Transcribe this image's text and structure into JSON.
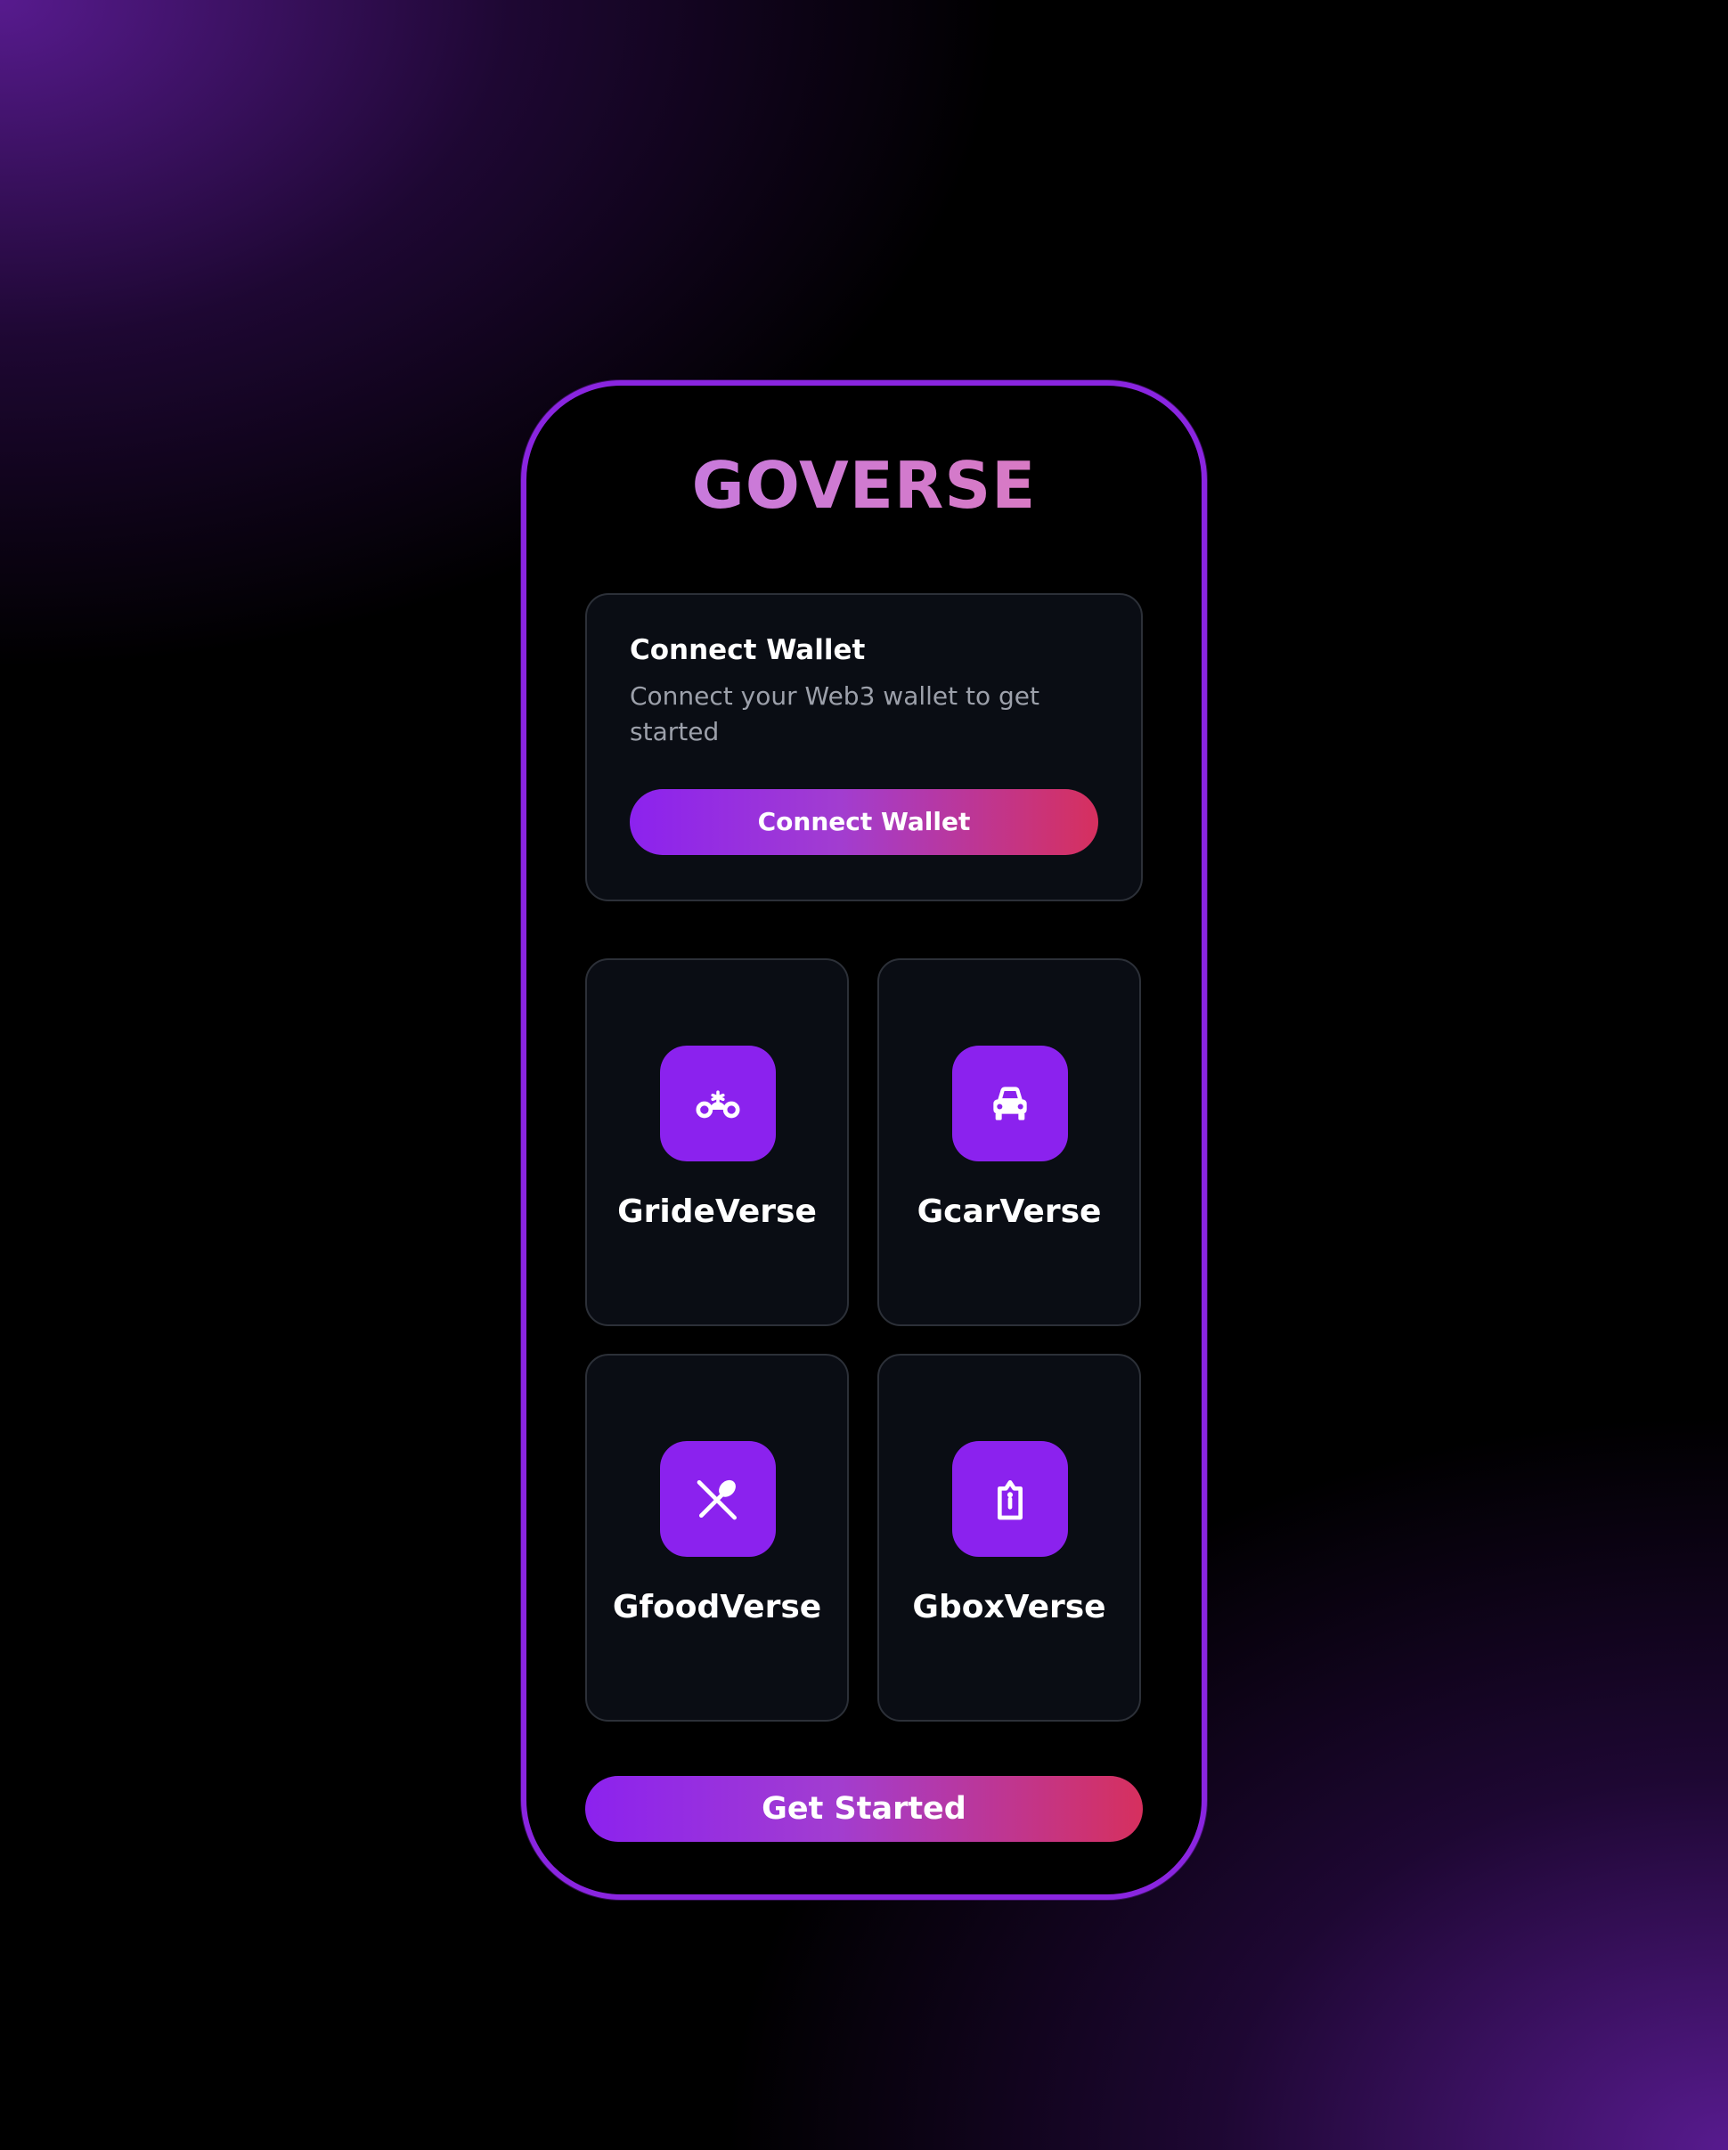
{
  "app": {
    "logo": "GOVERSE"
  },
  "wallet": {
    "title": "Connect Wallet",
    "description": "Connect your Web3 wallet to get started",
    "button_label": "Connect Wallet"
  },
  "services": [
    {
      "label": "GrideVerse",
      "icon": "motorbike-icon"
    },
    {
      "label": "GcarVerse",
      "icon": "car-icon"
    },
    {
      "label": "GfoodVerse",
      "icon": "food-utensils-icon"
    },
    {
      "label": "GboxVerse",
      "icon": "package-icon"
    }
  ],
  "cta": {
    "label": "Get Started"
  },
  "colors": {
    "accent_purple": "#8b22ee",
    "gradient_start": "#8c22ee",
    "gradient_end": "#d6305e",
    "card_bg": "#0a0d14",
    "phone_border": "#8a25e0"
  }
}
